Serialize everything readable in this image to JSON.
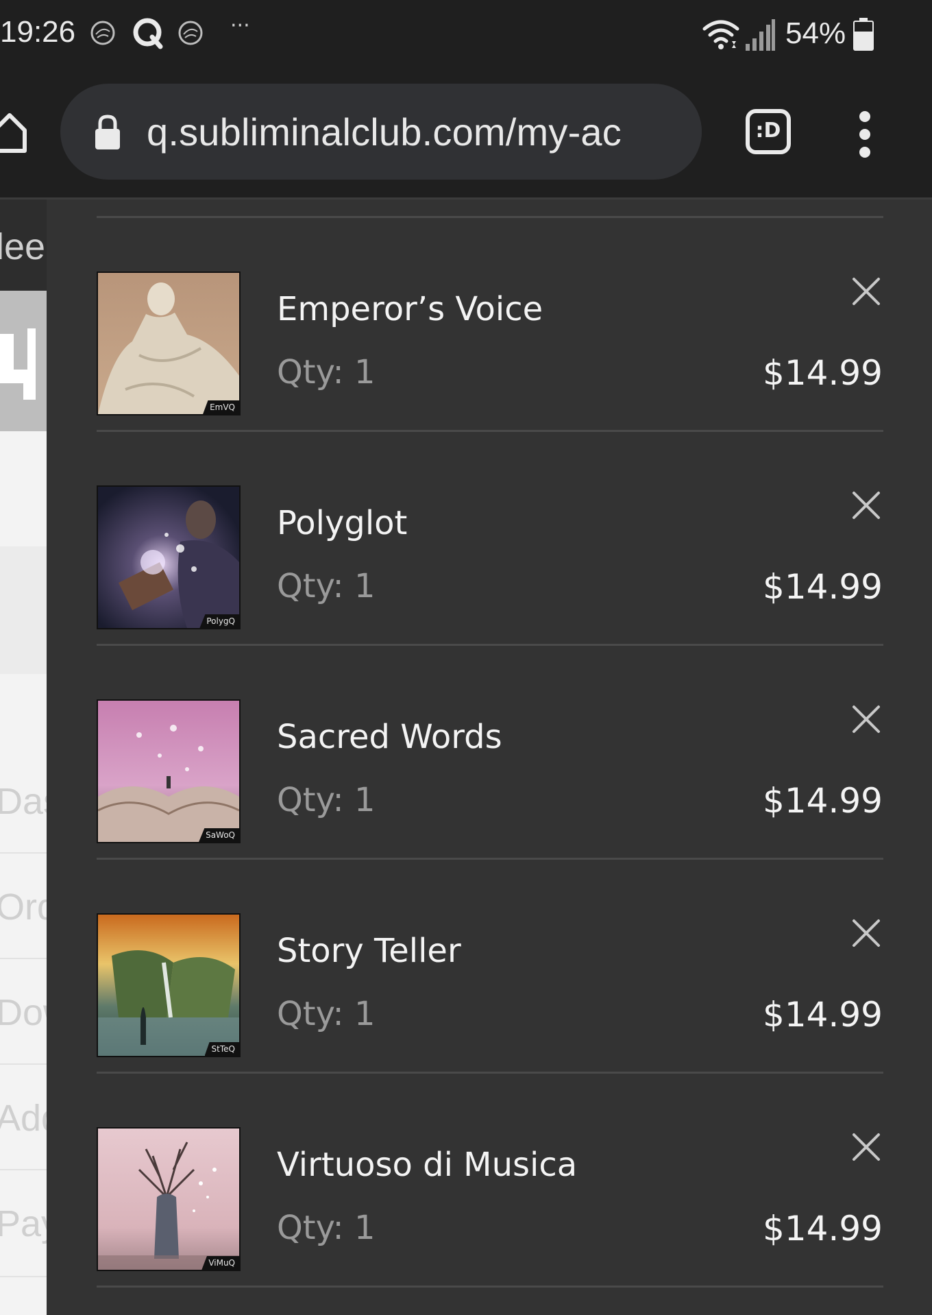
{
  "status_bar": {
    "time": "19:26",
    "more": "···",
    "battery": "54%",
    "icons": [
      "notification-badge-icon",
      "quora-icon",
      "notification-badge-icon",
      "wifi-icon",
      "signal-icon",
      "battery-icon"
    ]
  },
  "browser": {
    "url": "q.subliminalclub.com/my-ac",
    "icons": [
      "home-icon",
      "lock-icon",
      "tab-switcher-icon",
      "more-vert-icon"
    ],
    "tab_badge": ":D"
  },
  "background_page": {
    "partial_texts": [
      "lee",
      "Das",
      "Ord",
      "Dow",
      "Add",
      "Pay"
    ]
  },
  "cart": {
    "qty_label": "Qty:",
    "items": [
      {
        "name": "Emperor’s Voice",
        "qty": "1",
        "price": "$14.99",
        "thumb_tag": "EmVQ"
      },
      {
        "name": "Polyglot",
        "qty": "1",
        "price": "$14.99",
        "thumb_tag": "PolygQ"
      },
      {
        "name": "Sacred Words",
        "qty": "1",
        "price": "$14.99",
        "thumb_tag": "SaWoQ"
      },
      {
        "name": "Story Teller",
        "qty": "1",
        "price": "$14.99",
        "thumb_tag": "StTeQ"
      },
      {
        "name": "Virtuoso di Musica",
        "qty": "1",
        "price": "$14.99",
        "thumb_tag": "ViMuQ"
      }
    ]
  },
  "colors": {
    "panel_bg": "#333333",
    "chrome_bg": "#1f1f1f",
    "url_box_bg": "#303134",
    "text_primary": "#f4f4f4",
    "text_muted": "#9a9a9a"
  }
}
